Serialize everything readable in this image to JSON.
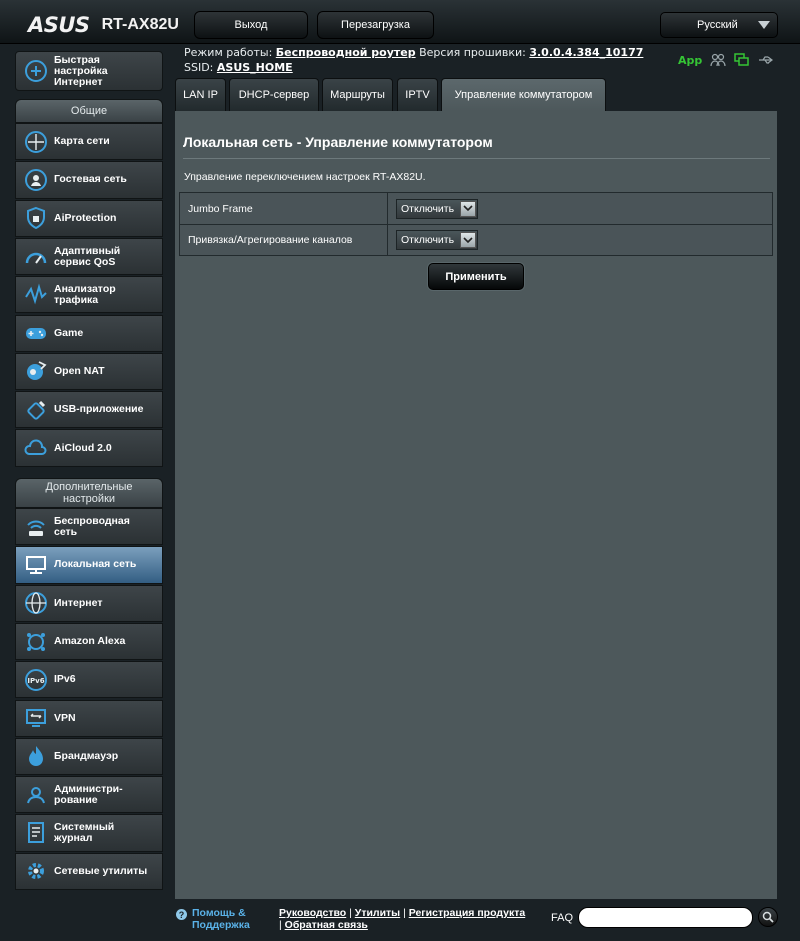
{
  "header": {
    "brand": "ASUS",
    "model": "RT-AX82U",
    "logout_label": "Выход",
    "reboot_label": "Перезагрузка",
    "language": "Русский"
  },
  "info": {
    "mode_label": "Режим работы:",
    "mode_value": "Беспроводной роутер",
    "firmware_label": "Версия прошивки:",
    "firmware_value": "3.0.0.4.384_10177",
    "ssid_label": "SSID:",
    "ssid_value": "ASUS_HOME",
    "app_label": "App"
  },
  "sidebar": {
    "quick_setup": "Быстрая настройка Интернет",
    "general_header": "Общие",
    "general_items": [
      {
        "label": "Карта сети",
        "icon": "network-map-icon"
      },
      {
        "label": "Гостевая сеть",
        "icon": "guest-network-icon"
      },
      {
        "label": "AiProtection",
        "icon": "aiprotection-icon"
      },
      {
        "label": "Адаптивный сервис QoS",
        "icon": "qos-icon"
      },
      {
        "label": "Анализатор трафика",
        "icon": "traffic-analyzer-icon"
      },
      {
        "label": "Game",
        "icon": "gamepad-icon"
      },
      {
        "label": "Open NAT",
        "icon": "open-nat-icon"
      },
      {
        "label": "USB-приложение",
        "icon": "usb-icon"
      },
      {
        "label": "AiCloud 2.0",
        "icon": "aicloud-icon"
      }
    ],
    "advanced_header": "Дополнительные настройки",
    "advanced_items": [
      {
        "label": "Беспроводная сеть",
        "icon": "wireless-icon"
      },
      {
        "label": "Локальная сеть",
        "icon": "lan-icon",
        "active": true
      },
      {
        "label": "Интернет",
        "icon": "globe-icon"
      },
      {
        "label": "Amazon Alexa",
        "icon": "alexa-icon"
      },
      {
        "label": "IPv6",
        "icon": "ipv6-icon"
      },
      {
        "label": "VPN",
        "icon": "vpn-icon"
      },
      {
        "label": "Брандмауэр",
        "icon": "firewall-icon"
      },
      {
        "label": "Администри-рование",
        "icon": "admin-icon"
      },
      {
        "label": "Системный журнал",
        "icon": "system-log-icon"
      },
      {
        "label": "Сетевые утилиты",
        "icon": "network-tools-icon"
      }
    ]
  },
  "tabs": [
    {
      "label": "LAN IP"
    },
    {
      "label": "DHCP-сервер"
    },
    {
      "label": "Маршруты"
    },
    {
      "label": "IPTV"
    },
    {
      "label": "Управление коммутатором",
      "active": true
    }
  ],
  "main": {
    "title": "Локальная сеть - Управление коммутатором",
    "description": "Управление переключением настроек RT-AX82U.",
    "settings": [
      {
        "label": "Jumbo Frame",
        "value": "Отключить"
      },
      {
        "label": "Привязка/Агрегирование каналов",
        "value": "Отключить"
      }
    ],
    "apply_label": "Применить"
  },
  "footer": {
    "help_label": "Помощь & Поддержка",
    "links": [
      "Руководство",
      "Утилиты",
      "Регистрация продукта",
      "Обратная связь"
    ],
    "faq_label": "FAQ",
    "faq_placeholder": ""
  },
  "colors": {
    "accent_active": "#4f7ea6",
    "app_green": "#35c535",
    "panel_bg": "#4d585b",
    "icon_blue": "#3c9fdc"
  }
}
